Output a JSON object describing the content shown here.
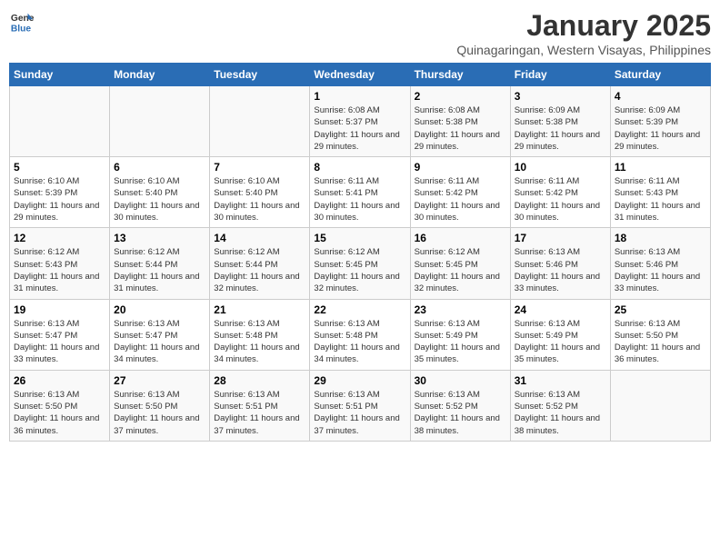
{
  "logo": {
    "general": "General",
    "blue": "Blue"
  },
  "header": {
    "month": "January 2025",
    "location": "Quinagaringan, Western Visayas, Philippines"
  },
  "weekdays": [
    "Sunday",
    "Monday",
    "Tuesday",
    "Wednesday",
    "Thursday",
    "Friday",
    "Saturday"
  ],
  "weeks": [
    [
      {
        "day": "",
        "sunrise": "",
        "sunset": "",
        "daylight": ""
      },
      {
        "day": "",
        "sunrise": "",
        "sunset": "",
        "daylight": ""
      },
      {
        "day": "",
        "sunrise": "",
        "sunset": "",
        "daylight": ""
      },
      {
        "day": "1",
        "sunrise": "Sunrise: 6:08 AM",
        "sunset": "Sunset: 5:37 PM",
        "daylight": "Daylight: 11 hours and 29 minutes."
      },
      {
        "day": "2",
        "sunrise": "Sunrise: 6:08 AM",
        "sunset": "Sunset: 5:38 PM",
        "daylight": "Daylight: 11 hours and 29 minutes."
      },
      {
        "day": "3",
        "sunrise": "Sunrise: 6:09 AM",
        "sunset": "Sunset: 5:38 PM",
        "daylight": "Daylight: 11 hours and 29 minutes."
      },
      {
        "day": "4",
        "sunrise": "Sunrise: 6:09 AM",
        "sunset": "Sunset: 5:39 PM",
        "daylight": "Daylight: 11 hours and 29 minutes."
      }
    ],
    [
      {
        "day": "5",
        "sunrise": "Sunrise: 6:10 AM",
        "sunset": "Sunset: 5:39 PM",
        "daylight": "Daylight: 11 hours and 29 minutes."
      },
      {
        "day": "6",
        "sunrise": "Sunrise: 6:10 AM",
        "sunset": "Sunset: 5:40 PM",
        "daylight": "Daylight: 11 hours and 30 minutes."
      },
      {
        "day": "7",
        "sunrise": "Sunrise: 6:10 AM",
        "sunset": "Sunset: 5:40 PM",
        "daylight": "Daylight: 11 hours and 30 minutes."
      },
      {
        "day": "8",
        "sunrise": "Sunrise: 6:11 AM",
        "sunset": "Sunset: 5:41 PM",
        "daylight": "Daylight: 11 hours and 30 minutes."
      },
      {
        "day": "9",
        "sunrise": "Sunrise: 6:11 AM",
        "sunset": "Sunset: 5:42 PM",
        "daylight": "Daylight: 11 hours and 30 minutes."
      },
      {
        "day": "10",
        "sunrise": "Sunrise: 6:11 AM",
        "sunset": "Sunset: 5:42 PM",
        "daylight": "Daylight: 11 hours and 30 minutes."
      },
      {
        "day": "11",
        "sunrise": "Sunrise: 6:11 AM",
        "sunset": "Sunset: 5:43 PM",
        "daylight": "Daylight: 11 hours and 31 minutes."
      }
    ],
    [
      {
        "day": "12",
        "sunrise": "Sunrise: 6:12 AM",
        "sunset": "Sunset: 5:43 PM",
        "daylight": "Daylight: 11 hours and 31 minutes."
      },
      {
        "day": "13",
        "sunrise": "Sunrise: 6:12 AM",
        "sunset": "Sunset: 5:44 PM",
        "daylight": "Daylight: 11 hours and 31 minutes."
      },
      {
        "day": "14",
        "sunrise": "Sunrise: 6:12 AM",
        "sunset": "Sunset: 5:44 PM",
        "daylight": "Daylight: 11 hours and 32 minutes."
      },
      {
        "day": "15",
        "sunrise": "Sunrise: 6:12 AM",
        "sunset": "Sunset: 5:45 PM",
        "daylight": "Daylight: 11 hours and 32 minutes."
      },
      {
        "day": "16",
        "sunrise": "Sunrise: 6:12 AM",
        "sunset": "Sunset: 5:45 PM",
        "daylight": "Daylight: 11 hours and 32 minutes."
      },
      {
        "day": "17",
        "sunrise": "Sunrise: 6:13 AM",
        "sunset": "Sunset: 5:46 PM",
        "daylight": "Daylight: 11 hours and 33 minutes."
      },
      {
        "day": "18",
        "sunrise": "Sunrise: 6:13 AM",
        "sunset": "Sunset: 5:46 PM",
        "daylight": "Daylight: 11 hours and 33 minutes."
      }
    ],
    [
      {
        "day": "19",
        "sunrise": "Sunrise: 6:13 AM",
        "sunset": "Sunset: 5:47 PM",
        "daylight": "Daylight: 11 hours and 33 minutes."
      },
      {
        "day": "20",
        "sunrise": "Sunrise: 6:13 AM",
        "sunset": "Sunset: 5:47 PM",
        "daylight": "Daylight: 11 hours and 34 minutes."
      },
      {
        "day": "21",
        "sunrise": "Sunrise: 6:13 AM",
        "sunset": "Sunset: 5:48 PM",
        "daylight": "Daylight: 11 hours and 34 minutes."
      },
      {
        "day": "22",
        "sunrise": "Sunrise: 6:13 AM",
        "sunset": "Sunset: 5:48 PM",
        "daylight": "Daylight: 11 hours and 34 minutes."
      },
      {
        "day": "23",
        "sunrise": "Sunrise: 6:13 AM",
        "sunset": "Sunset: 5:49 PM",
        "daylight": "Daylight: 11 hours and 35 minutes."
      },
      {
        "day": "24",
        "sunrise": "Sunrise: 6:13 AM",
        "sunset": "Sunset: 5:49 PM",
        "daylight": "Daylight: 11 hours and 35 minutes."
      },
      {
        "day": "25",
        "sunrise": "Sunrise: 6:13 AM",
        "sunset": "Sunset: 5:50 PM",
        "daylight": "Daylight: 11 hours and 36 minutes."
      }
    ],
    [
      {
        "day": "26",
        "sunrise": "Sunrise: 6:13 AM",
        "sunset": "Sunset: 5:50 PM",
        "daylight": "Daylight: 11 hours and 36 minutes."
      },
      {
        "day": "27",
        "sunrise": "Sunrise: 6:13 AM",
        "sunset": "Sunset: 5:50 PM",
        "daylight": "Daylight: 11 hours and 37 minutes."
      },
      {
        "day": "28",
        "sunrise": "Sunrise: 6:13 AM",
        "sunset": "Sunset: 5:51 PM",
        "daylight": "Daylight: 11 hours and 37 minutes."
      },
      {
        "day": "29",
        "sunrise": "Sunrise: 6:13 AM",
        "sunset": "Sunset: 5:51 PM",
        "daylight": "Daylight: 11 hours and 37 minutes."
      },
      {
        "day": "30",
        "sunrise": "Sunrise: 6:13 AM",
        "sunset": "Sunset: 5:52 PM",
        "daylight": "Daylight: 11 hours and 38 minutes."
      },
      {
        "day": "31",
        "sunrise": "Sunrise: 6:13 AM",
        "sunset": "Sunset: 5:52 PM",
        "daylight": "Daylight: 11 hours and 38 minutes."
      },
      {
        "day": "",
        "sunrise": "",
        "sunset": "",
        "daylight": ""
      }
    ]
  ]
}
